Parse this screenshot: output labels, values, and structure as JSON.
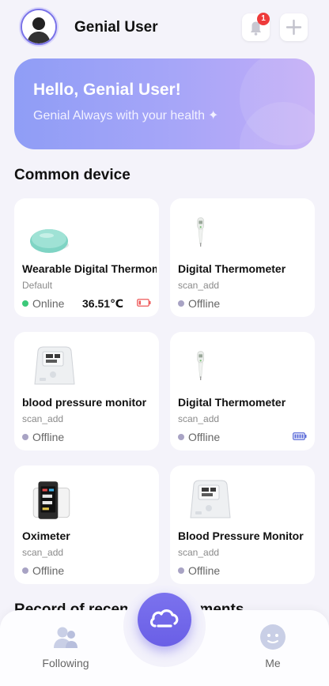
{
  "header": {
    "username": "Genial User",
    "notification_count": "1"
  },
  "banner": {
    "title": "Hello, Genial User!",
    "subtitle": "Genial Always with your health",
    "sparkle": "✦"
  },
  "section": {
    "common_device": "Common device"
  },
  "devices": [
    {
      "name": "Wearable Digital Thermometer",
      "sub": "Default",
      "status": "Online",
      "temperature": "36.51℃",
      "battery": "low"
    },
    {
      "name": "Digital Thermometer",
      "sub": "scan_add",
      "status": "Offline"
    },
    {
      "name": "blood pressure monitor",
      "sub": "scan_add",
      "status": "Offline"
    },
    {
      "name": "Digital Thermometer",
      "sub": "scan_add",
      "status": "Offline",
      "battery": "full"
    },
    {
      "name": "Oximeter",
      "sub": "scan_add",
      "status": "Offline"
    },
    {
      "name": "Blood Pressure Monitor",
      "sub": "scan_add",
      "status": "Offline"
    }
  ],
  "records_title": "Record of recent measurements",
  "nav": {
    "following": "Following",
    "me": "Me"
  },
  "colors": {
    "accent": "#6a5fe6",
    "online": "#3cc97a",
    "offline": "#a8a3c4",
    "battery_low": "#ee5a5a",
    "battery_full": "#5b6bd8"
  }
}
